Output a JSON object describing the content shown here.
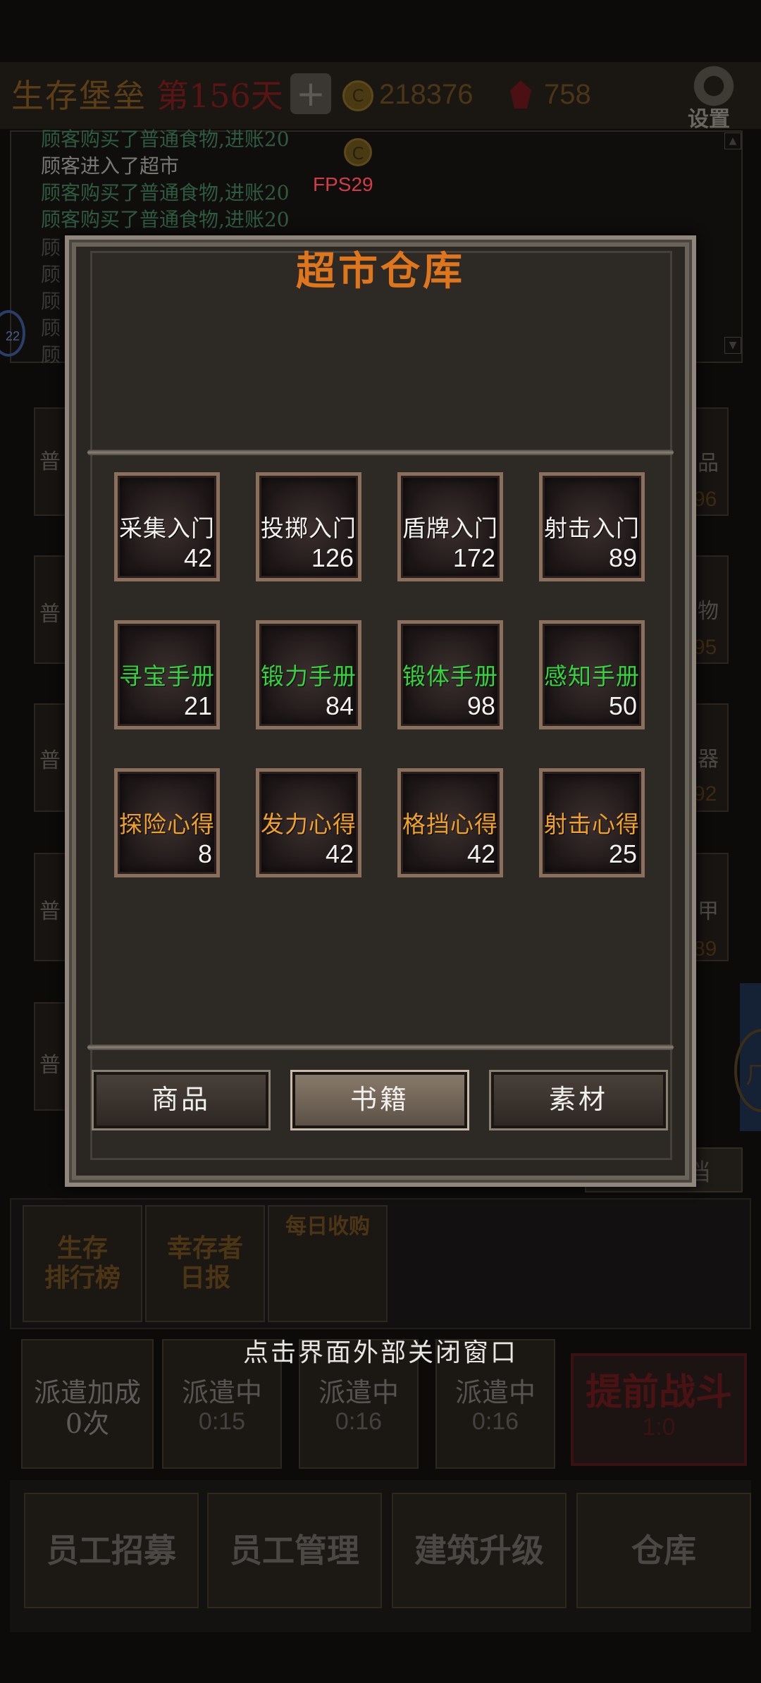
{
  "header": {
    "title": "生存堡垒",
    "day": "第156天",
    "coins": "218376",
    "gems": "758",
    "settings_label": "设置",
    "coin_glyph": "C",
    "plus_glyph": "+"
  },
  "log": {
    "lines": [
      "顾客购买了普通食物,进账20",
      "顾客进入了超市",
      "顾客购买了普通食物,进账20",
      "顾客购买了普通食物,进账20",
      "顾",
      "顾",
      "顾",
      "顾",
      "顾"
    ],
    "fps": "FPS29",
    "avatar_badge": "22"
  },
  "background": {
    "left_slots": [
      "普",
      "普",
      "普",
      "普",
      "普"
    ],
    "right_slots": [
      {
        "label": "品",
        "num": "96"
      },
      {
        "label": "物",
        "num": "95"
      },
      {
        "label": "器",
        "num": "92"
      },
      {
        "label": "甲",
        "num": "89"
      }
    ],
    "dang_tab": "档",
    "round_btn": "ㄏ",
    "rank_button": "生存\n排行榜",
    "rank_line1": "生存",
    "rank_line2": "排行榜",
    "report_line1": "幸存者",
    "report_line2": "日报",
    "daily_buy": "每日收购",
    "close_hint": "点击界面外部关闭窗口",
    "dispatch_bonus": "派遣加成",
    "dispatch_count": "0次",
    "dispatching": [
      {
        "label": "派遣中",
        "time": "0:15"
      },
      {
        "label": "派遣中",
        "time": "0:16"
      },
      {
        "label": "派遣中",
        "time": "0:16"
      }
    ],
    "fight_label": "提前战斗",
    "fight_time": "1:0",
    "bottom_buttons": [
      "员工招募",
      "员工管理",
      "建筑升级",
      "仓库"
    ]
  },
  "modal": {
    "title": "超市仓库",
    "items": [
      {
        "name": "采集入门",
        "count": "42",
        "color": "#f4f2ee"
      },
      {
        "name": "投掷入门",
        "count": "126",
        "color": "#f4f2ee"
      },
      {
        "name": "盾牌入门",
        "count": "172",
        "color": "#f4f2ee"
      },
      {
        "name": "射击入门",
        "count": "89",
        "color": "#f4f2ee"
      },
      {
        "name": "寻宝手册",
        "count": "21",
        "color": "#35d43c"
      },
      {
        "name": "锻力手册",
        "count": "84",
        "color": "#35d43c"
      },
      {
        "name": "锻体手册",
        "count": "98",
        "color": "#35d43c"
      },
      {
        "name": "感知手册",
        "count": "50",
        "color": "#35d43c"
      },
      {
        "name": "探险心得",
        "count": "8",
        "color": "#f0a226"
      },
      {
        "name": "发力心得",
        "count": "42",
        "color": "#f0a226"
      },
      {
        "name": "格挡心得",
        "count": "42",
        "color": "#f0a226"
      },
      {
        "name": "射击心得",
        "count": "25",
        "color": "#f0a226"
      }
    ],
    "tabs": [
      {
        "label": "商品",
        "active": false
      },
      {
        "label": "书籍",
        "active": true
      },
      {
        "label": "素材",
        "active": false
      }
    ]
  }
}
